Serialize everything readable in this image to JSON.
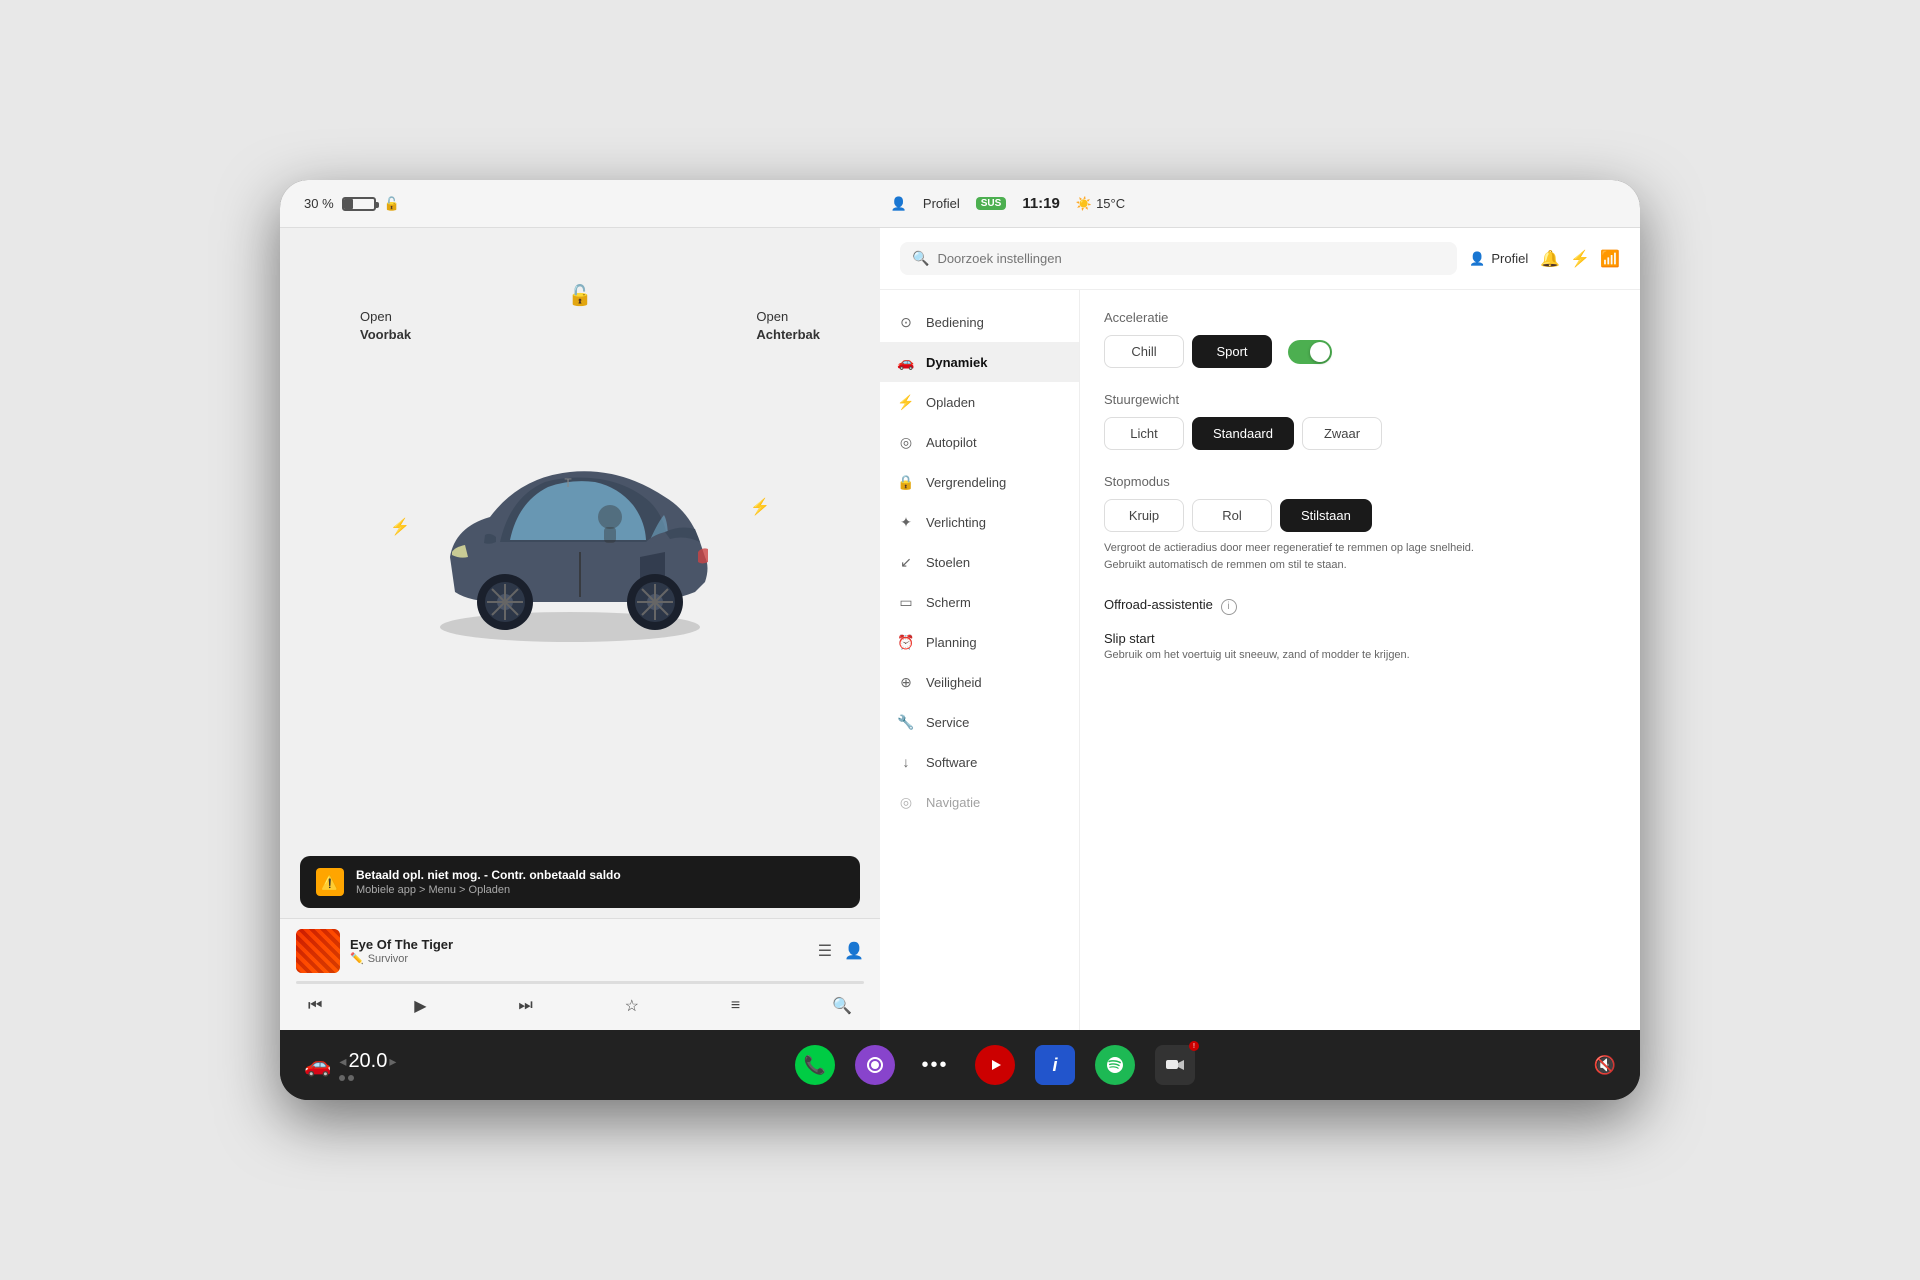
{
  "screen": {
    "status_bar": {
      "battery_percent": "30 %",
      "lock_icon": "🔓",
      "profile_label": "Profiel",
      "sus_badge": "SUS",
      "time": "11:19",
      "weather_icon": "☀️",
      "temperature": "15°C"
    },
    "left_panel": {
      "open_voorbak": "Open\nVoorbak",
      "open_achterbak_line1": "Open",
      "open_achterbak_line2": "Achterbak",
      "warning": {
        "title": "Betaald opl. niet mog. - Contr. onbetaald saldo",
        "subtitle": "Mobiele app > Menu > Opladen"
      },
      "music": {
        "title": "Eye Of The Tiger",
        "artist": "Survivor"
      }
    },
    "settings": {
      "search_placeholder": "Doorzoek instellingen",
      "profile_label": "Profiel",
      "nav_items": [
        {
          "id": "bediening",
          "label": "Bediening",
          "icon": "⊙"
        },
        {
          "id": "dynamiek",
          "label": "Dynamiek",
          "icon": "🚗",
          "active": true
        },
        {
          "id": "opladen",
          "label": "Opladen",
          "icon": "⚡"
        },
        {
          "id": "autopilot",
          "label": "Autopilot",
          "icon": "◎"
        },
        {
          "id": "vergrendeling",
          "label": "Vergrendeling",
          "icon": "🔒"
        },
        {
          "id": "verlichting",
          "label": "Verlichting",
          "icon": "✦"
        },
        {
          "id": "stoelen",
          "label": "Stoelen",
          "icon": "↙"
        },
        {
          "id": "scherm",
          "label": "Scherm",
          "icon": "▭"
        },
        {
          "id": "planning",
          "label": "Planning",
          "icon": "⏰"
        },
        {
          "id": "veiligheid",
          "label": "Veiligheid",
          "icon": "⊕"
        },
        {
          "id": "service",
          "label": "Service",
          "icon": "🔧"
        },
        {
          "id": "software",
          "label": "Software",
          "icon": "↓"
        },
        {
          "id": "navigatie",
          "label": "Navigatie",
          "icon": "◎"
        }
      ],
      "content": {
        "acceleratie": {
          "title": "Acceleratie",
          "options": [
            {
              "label": "Chill",
              "active": false
            },
            {
              "label": "Sport",
              "active": true
            }
          ],
          "toggle_on": true
        },
        "stuurgewicht": {
          "title": "Stuurgewicht",
          "options": [
            {
              "label": "Licht",
              "active": false
            },
            {
              "label": "Standaard",
              "active": true
            },
            {
              "label": "Zwaar",
              "active": false
            }
          ]
        },
        "stopmodus": {
          "title": "Stopmodus",
          "options": [
            {
              "label": "Kruip",
              "active": false
            },
            {
              "label": "Rol",
              "active": false
            },
            {
              "label": "Stilstaan",
              "active": true
            }
          ],
          "description": "Vergroot de actieradius door meer regeneratief te remmen op lage snelheid. Gebruikt automatisch de remmen om stil te staan."
        },
        "offroad": {
          "title": "Offroad-assistentie",
          "has_info": true
        },
        "slip_start": {
          "title": "Slip start",
          "description": "Gebruik om het voertuig uit sneeuw, zand of modder te krijgen."
        }
      }
    },
    "taskbar": {
      "speed": "20.0",
      "speed_unit": "",
      "icons": [
        {
          "id": "phone",
          "label": "📞",
          "type": "phone"
        },
        {
          "id": "camera",
          "label": "●",
          "type": "camera"
        },
        {
          "id": "more",
          "label": "•••",
          "type": "more"
        },
        {
          "id": "record",
          "label": "▶",
          "type": "record"
        },
        {
          "id": "info",
          "label": "i",
          "type": "info"
        },
        {
          "id": "spotify",
          "label": "♪",
          "type": "spotify"
        },
        {
          "id": "dashcam",
          "label": "📷",
          "type": "dashcam"
        }
      ],
      "volume_icon": "🔇"
    }
  }
}
